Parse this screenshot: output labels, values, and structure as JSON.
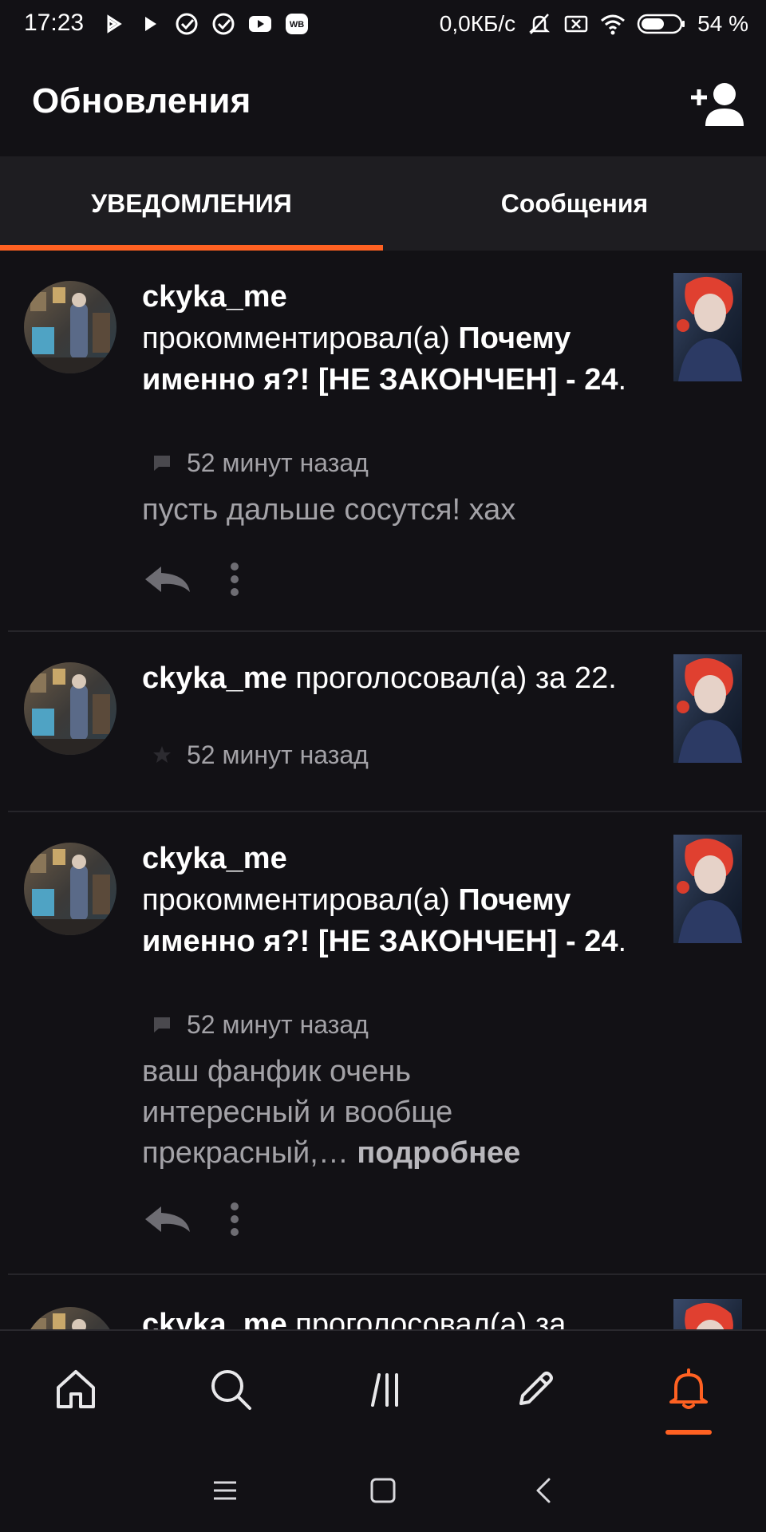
{
  "status_bar": {
    "time": "17:23",
    "network_speed": "0,0КБ/с",
    "battery": "54 %",
    "icons_left": [
      "play-icon",
      "play-icon",
      "check-circle-icon",
      "check-circle-icon",
      "youtube-icon",
      "wb-icon"
    ],
    "icons_right": [
      "mute-icon",
      "sim-off-icon",
      "wifi-icon",
      "battery-icon"
    ]
  },
  "header": {
    "title": "Обновления",
    "action_icon": "add-user-icon"
  },
  "tabs": [
    {
      "label": "УВЕДОМЛЕНИЯ",
      "active": true
    },
    {
      "label": "Сообщения",
      "active": false
    }
  ],
  "notifications": [
    {
      "user": "ckyka_me",
      "action": "прокомментировал(а)",
      "target": "Почему именно я?! [НЕ ЗАКОНЧЕН] - 24",
      "punct": ".",
      "meta_icon": "comment-icon",
      "time": "52 минут назад",
      "comment": "пусть дальше сосутся! хах",
      "more": ""
    },
    {
      "user": "ckyka_me",
      "action": "проголосовал(а) за",
      "target": "22",
      "punct": ".",
      "meta_icon": "star-icon",
      "time": "52 минут назад"
    },
    {
      "user": "ckyka_me",
      "action": "прокомментировал(а)",
      "target": "Почему именно я?! [НЕ ЗАКОНЧЕН] - 24",
      "punct": ".",
      "meta_icon": "comment-icon",
      "time": "52 минут назад",
      "comment": "ваш фанфик очень интересный и вообще прекрасный,…",
      "more": "подробнее"
    },
    {
      "user": "ckyka_me",
      "action": "проголосовал(а) за",
      "target": "",
      "punct": ""
    }
  ],
  "bottom_nav": [
    {
      "icon": "home-icon",
      "active": false
    },
    {
      "icon": "search-icon",
      "active": false
    },
    {
      "icon": "library-icon",
      "active": false
    },
    {
      "icon": "write-icon",
      "active": false
    },
    {
      "icon": "bell-icon",
      "active": true
    }
  ],
  "colors": {
    "accent": "#ff6122",
    "background": "#121115",
    "tab_bar": "#1e1d21",
    "secondary_text": "#a3a2a7"
  }
}
